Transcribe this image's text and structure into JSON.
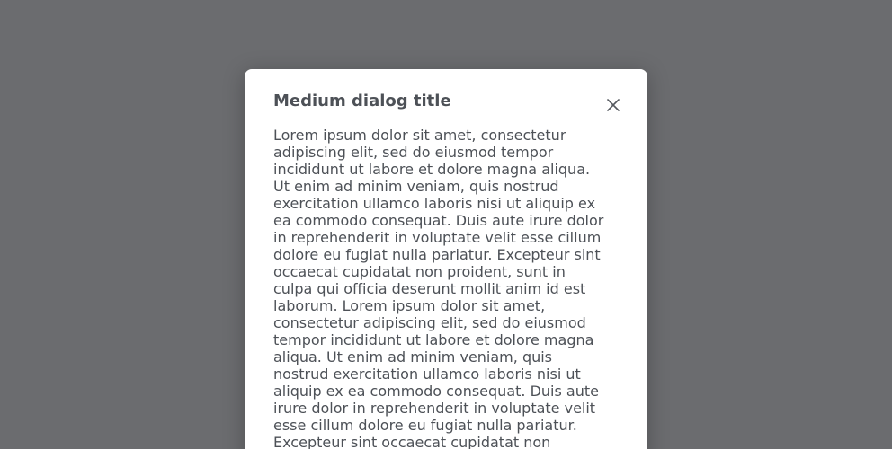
{
  "dialog": {
    "title": "Medium dialog title",
    "close_icon": "close-icon",
    "body": "Lorem ipsum dolor sit amet, consectetur adipiscing elit, sed do eiusmod tempor incididunt ut labore et dolore magna aliqua. Ut enim ad minim veniam, quis nostrud exercitation ullamco laboris nisi ut aliquip ex ea commodo consequat. Duis aute irure dolor in reprehenderit in voluptate velit esse cillum dolore eu fugiat nulla pariatur. Excepteur sint occaecat cupidatat non proident, sunt in culpa qui officia deserunt mollit anim id est laborum. Lorem ipsum dolor sit amet, consectetur adipiscing elit, sed do eiusmod tempor incididunt ut labore et dolore magna aliqua. Ut enim ad minim veniam, quis nostrud exercitation ullamco laboris nisi ut aliquip ex ea commodo consequat. Duis aute irure dolor in reprehenderit in voluptate velit esse cillum dolore eu fugiat nulla pariatur. Excepteur sint occaecat cupidatat non"
  },
  "colors": {
    "backdrop": "#6b6c6f",
    "surface": "#ffffff",
    "text": "#4d5157"
  }
}
